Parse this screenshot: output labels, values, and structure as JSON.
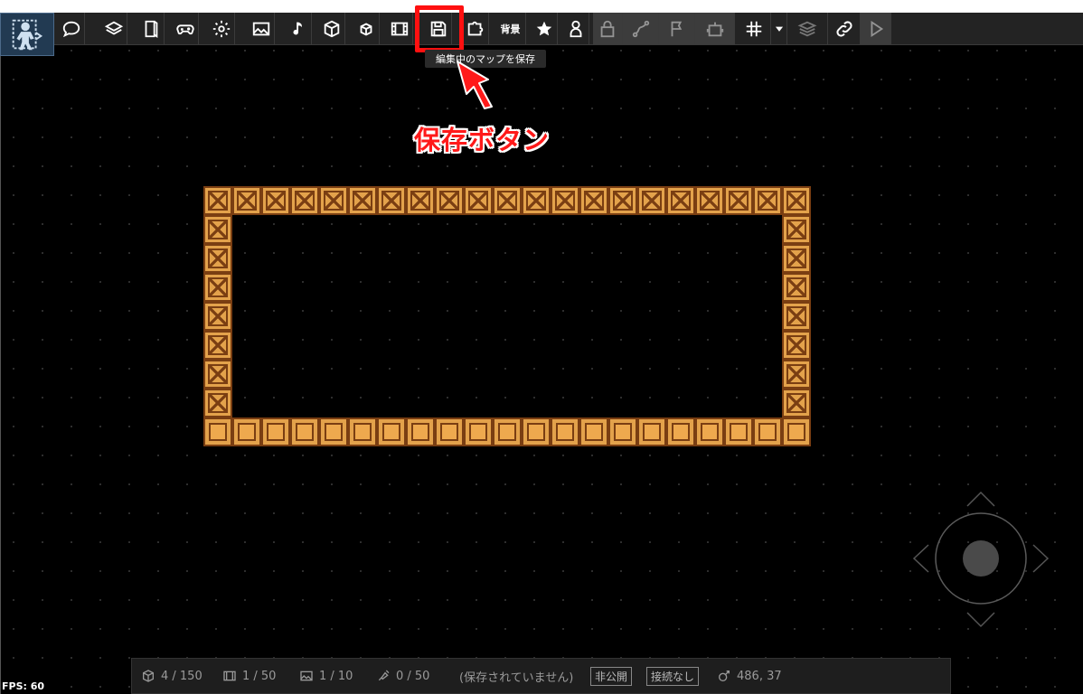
{
  "toolbar": {
    "tooltip": "編集中のマップを保存",
    "background_label": "背景"
  },
  "annotation": {
    "callout_text": "保存ボタン",
    "highlight_color": "#ff1010"
  },
  "status": {
    "blocks": "4 / 150",
    "film": "1 / 50",
    "images": "1 / 10",
    "scripts": "0 / 50",
    "save_state": "(保存されていません)",
    "visibility": "非公開",
    "connection": "接続なし",
    "coordinates": "486, 37"
  },
  "fps": "FPS: 60",
  "icons": [
    "comment-icon",
    "layers-icon",
    "book-icon",
    "gamepad-icon",
    "gear-icon",
    "image-icon",
    "music-icon",
    "cube-icon",
    "small-cube-icon",
    "film-icon",
    "save-icon",
    "puzzle-icon",
    "background-label",
    "star-icon",
    "person-icon",
    "lock-icon",
    "path-icon",
    "flag-icon",
    "robot-icon",
    "grid-icon",
    "dropdown-icon",
    "stack-icon",
    "link-icon",
    "play-icon"
  ],
  "colors": {
    "tile_fill": "#e3a24b",
    "tile_border": "#7a3e12",
    "callout": "#ff1a1a"
  }
}
